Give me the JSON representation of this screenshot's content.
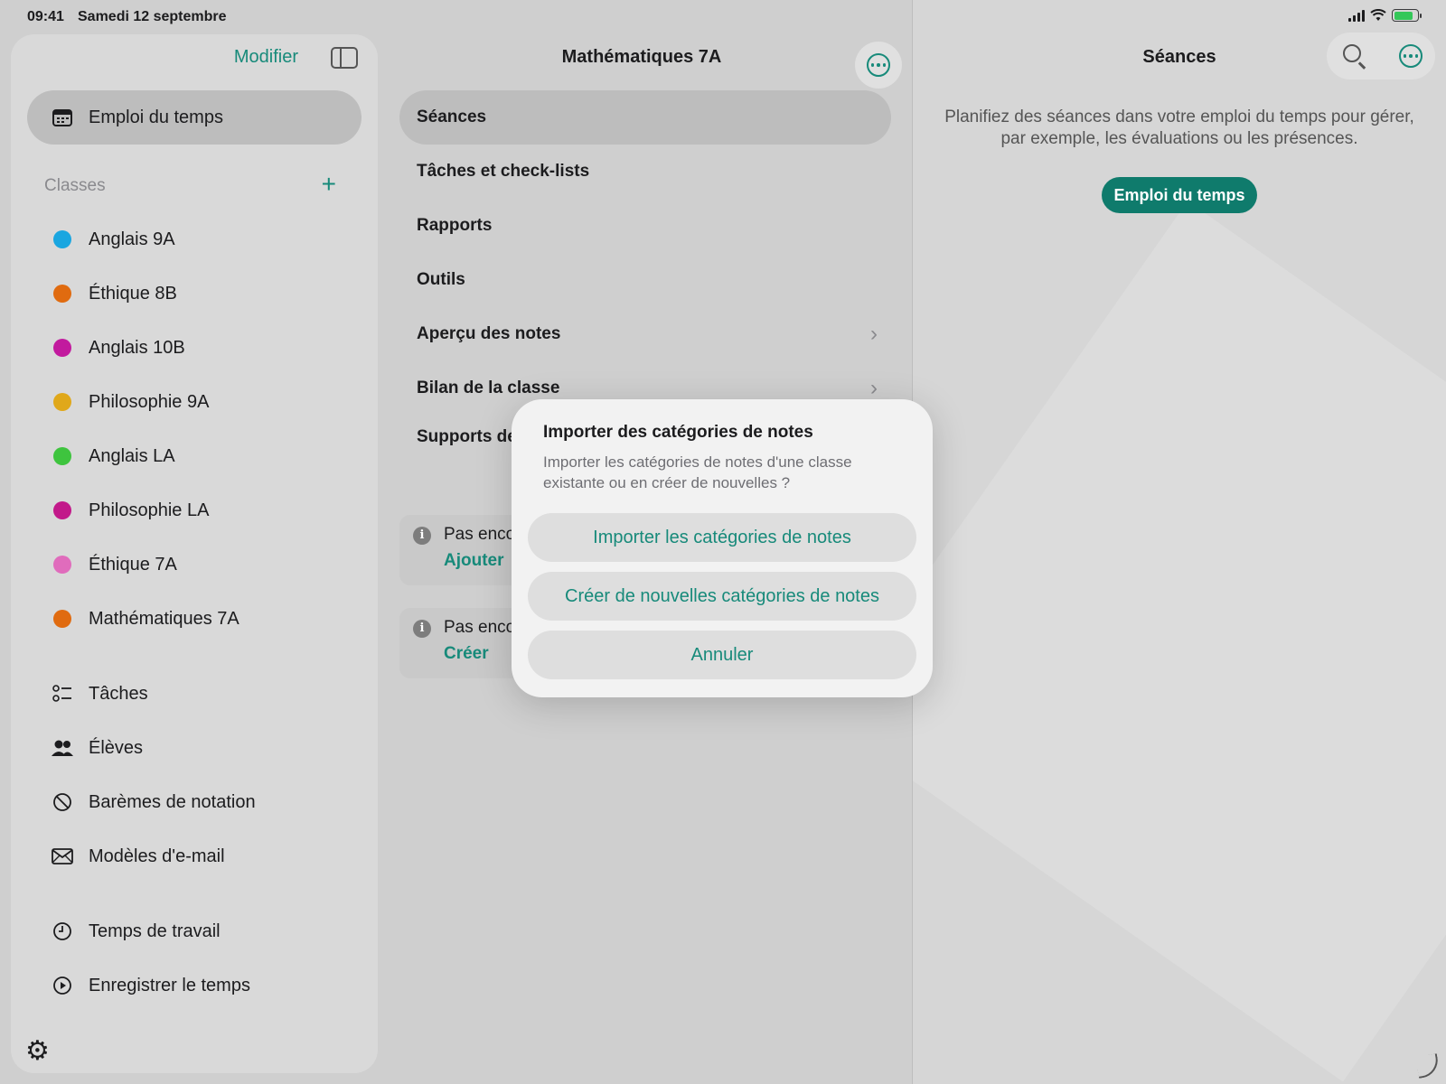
{
  "status_bar": {
    "time": "09:41",
    "date": "Samedi 12 septembre",
    "battery_color": "#34c759"
  },
  "sidebar": {
    "edit_label": "Modifier",
    "selected_item": {
      "label": "Emploi du temps",
      "icon": "calendar-icon"
    },
    "classes_title": "Classes",
    "add_icon": "plus-icon",
    "classes": [
      {
        "label": "Anglais 9A",
        "color": "#1aa6e0"
      },
      {
        "label": "Éthique 8B",
        "color": "#e06b10"
      },
      {
        "label": "Anglais 10B",
        "color": "#c21a9e"
      },
      {
        "label": "Philosophie 9A",
        "color": "#e0a81a"
      },
      {
        "label": "Anglais LA",
        "color": "#3ec43e"
      },
      {
        "label": "Philosophie LA",
        "color": "#c2198a"
      },
      {
        "label": "Éthique 7A",
        "color": "#e06cbc"
      },
      {
        "label": "Mathématiques 7A",
        "color": "#e06b10"
      }
    ],
    "tools": [
      {
        "label": "Tâches",
        "icon": "checklist-icon"
      },
      {
        "label": "Élèves",
        "icon": "people-icon"
      },
      {
        "label": "Barèmes de notation",
        "icon": "grading-scale-icon"
      },
      {
        "label": "Modèles d'e-mail",
        "icon": "envelope-icon"
      }
    ],
    "time_items": [
      {
        "label": "Temps de travail",
        "icon": "clock-icon"
      },
      {
        "label": "Enregistrer le temps",
        "icon": "play-circle-icon"
      }
    ],
    "settings_icon": "gear-icon"
  },
  "middle": {
    "title": "Mathématiques 7A",
    "items": [
      {
        "label": "Séances",
        "selected": true
      },
      {
        "label": "Tâches et check-lists"
      },
      {
        "label": "Rapports"
      },
      {
        "label": "Outils"
      },
      {
        "label": "Aperçu des notes",
        "chevron": true
      },
      {
        "label": "Bilan de la classe",
        "chevron": true
      },
      {
        "label": "Supports de"
      }
    ],
    "info_cards": [
      {
        "text": "Pas enco",
        "link": "Ajouter"
      },
      {
        "text": "Pas enco",
        "link": "Créer"
      }
    ]
  },
  "right": {
    "title": "Séances",
    "message_line1": "Planifiez des séances dans votre emploi du temps pour gérer,",
    "message_line2": "par exemple, les évaluations ou les présences.",
    "cta": "Emploi du temps",
    "accent": "#0f7b6c"
  },
  "dialog": {
    "title": "Importer des catégories de notes",
    "message": "Importer les catégories de notes d'une classe existante ou en créer de nouvelles ?",
    "buttons": [
      "Importer les catégories de notes",
      "Créer de nouvelles catégories de notes",
      "Annuler"
    ]
  }
}
